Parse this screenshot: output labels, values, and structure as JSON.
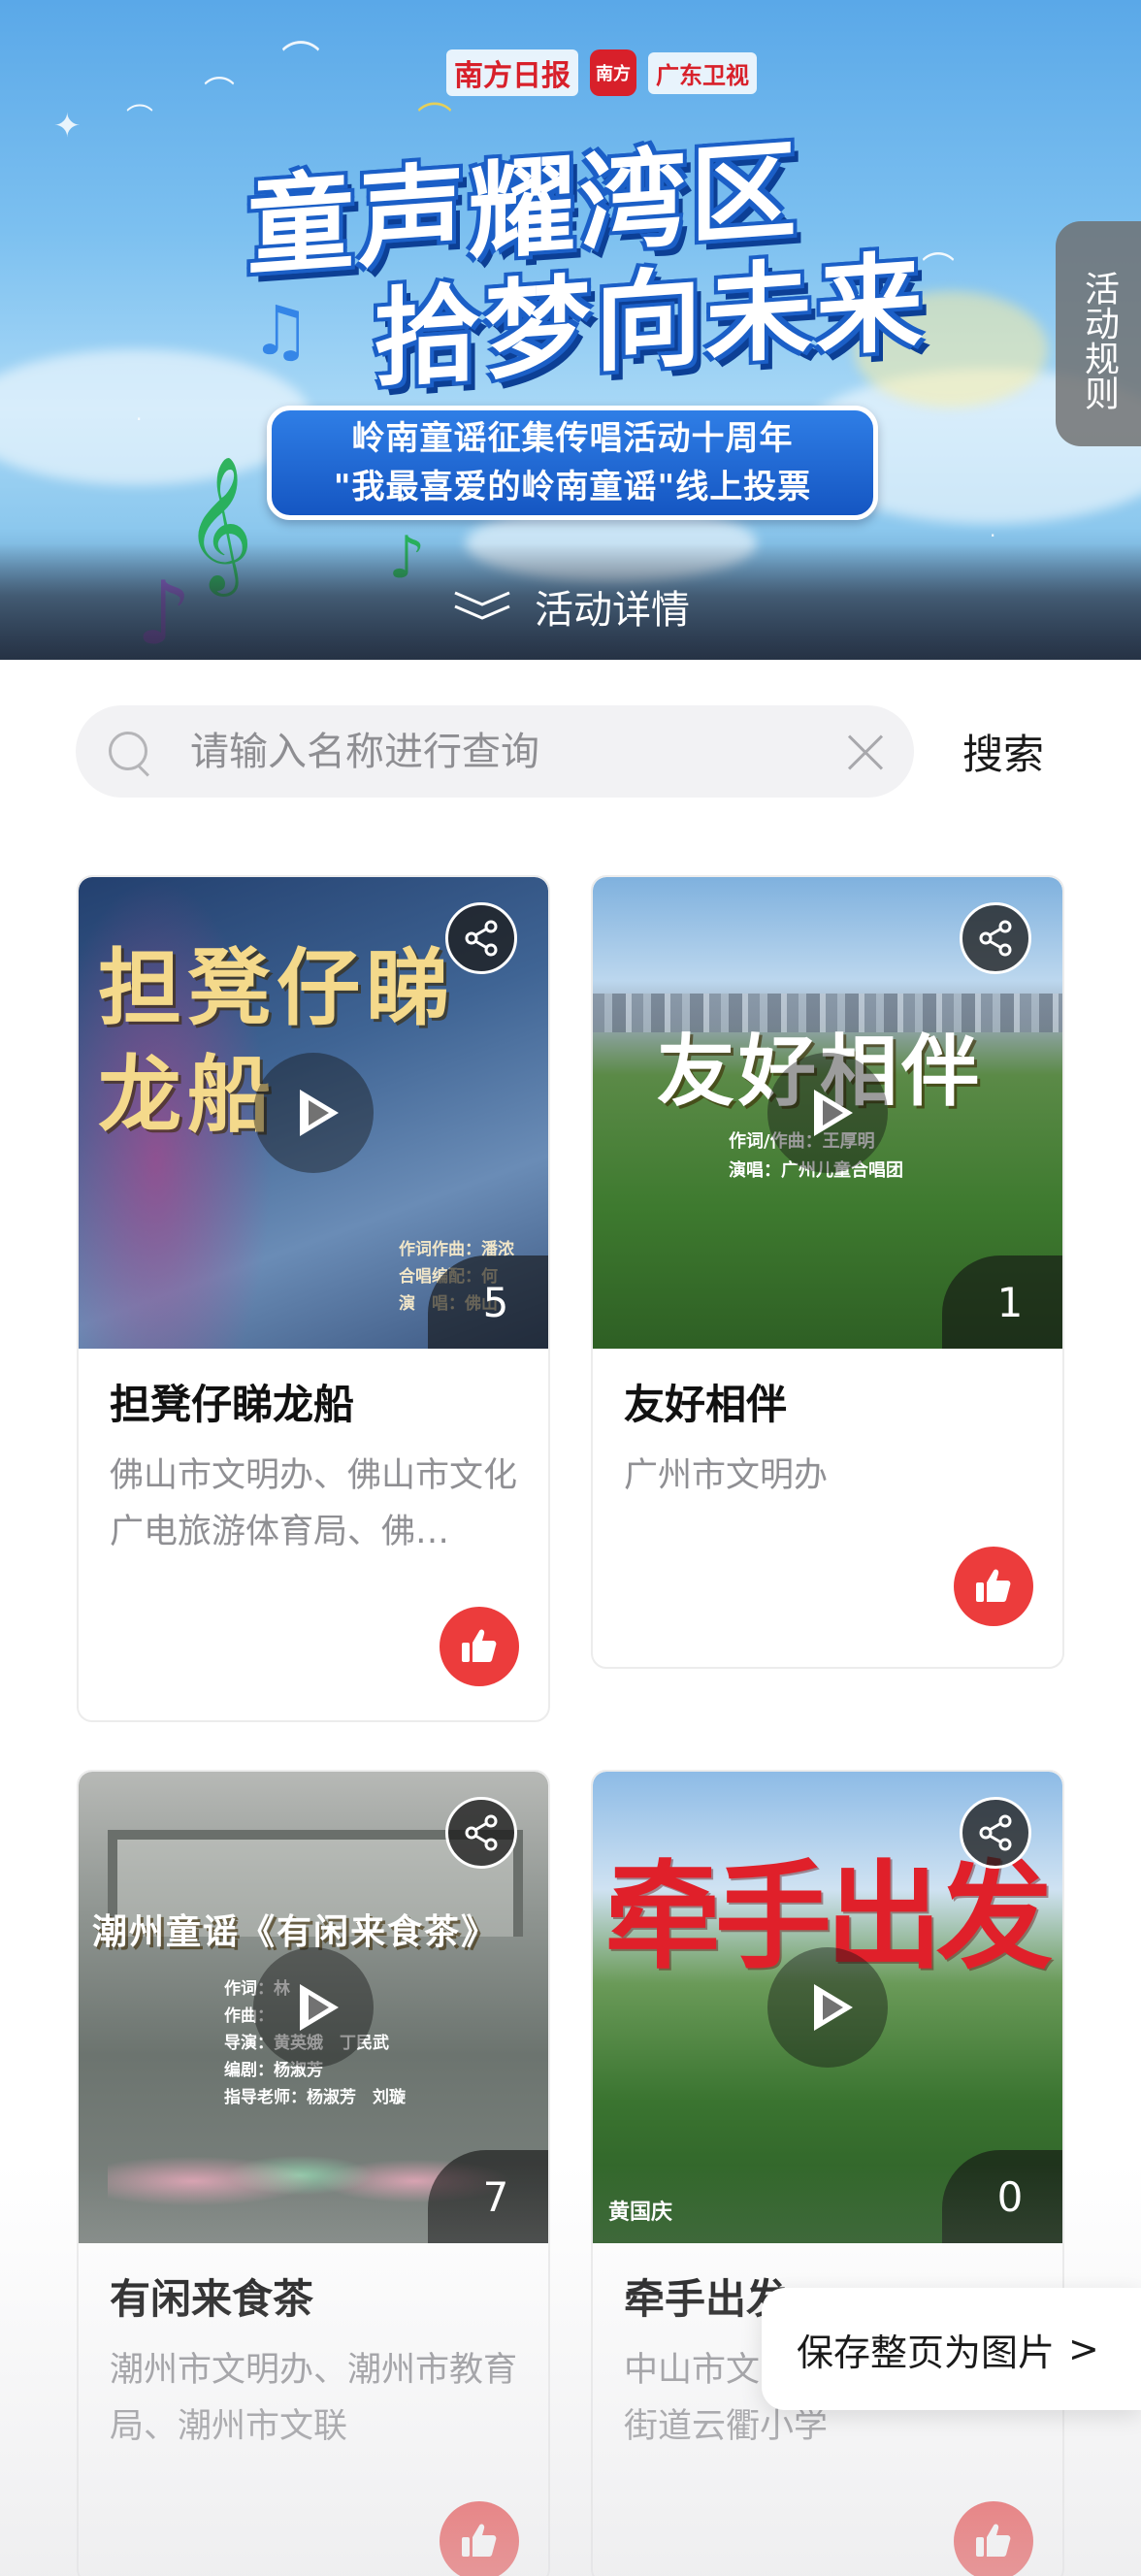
{
  "banner": {
    "logos": [
      "南方日报",
      "南方+",
      "广东卫视"
    ],
    "headline_line1": "童声耀湾区",
    "headline_line2": "拾梦向未来",
    "subtitle_line1": "岭南童谣征集传唱活动十周年",
    "subtitle_line2": "\"我最喜爱的岭南童谣\"线上投票",
    "rules_label": "活动规则",
    "detail_label": "活动详情"
  },
  "search": {
    "placeholder": "请输入名称进行查询",
    "value": "",
    "button_label": "搜索"
  },
  "cards": [
    {
      "thumb_title": "担凳仔睇龙船",
      "thumb_credits": "作词作曲：潘浓\n合唱编配：何\n演　唱：佛山",
      "title": "担凳仔睇龙船",
      "org": "佛山市文明办、佛山市文化广电旅游体育局、佛…",
      "count": "5",
      "colors": [
        "#2f4d7a",
        "#5e7fa8"
      ]
    },
    {
      "thumb_title": "友好相伴",
      "thumb_credits": "作词/作曲：王厚明\n演唱：广州儿童合唱团",
      "title": "友好相伴",
      "org": "广州市文明办",
      "count": "1",
      "colors": [
        "#8fb9e0",
        "#3f7a2e"
      ]
    },
    {
      "thumb_title": "潮州童谣《有闲来食茶》",
      "thumb_credits": "作词：林\n作曲：\n导演：黄英娥　丁民武\n编剧：杨淑芳\n指导老师：杨淑芳　刘璇",
      "title": "有闲来食茶",
      "org": "潮州市文明办、潮州市教育局、潮州市文联",
      "count": "7",
      "colors": [
        "#8a8d8c",
        "#5f6a62"
      ]
    },
    {
      "thumb_title": "牵手出发",
      "thumb_credits": "黄国庆",
      "title": "牵手出发",
      "org": "中山市文明办、中山市南朗街道云衢小学",
      "count": "0",
      "colors": [
        "#9cc4e8",
        "#2f6b35"
      ]
    }
  ],
  "save_float": {
    "label": "保存整页为图片",
    "arrow": ">"
  },
  "colors": {
    "like_red": "#ec3c3c",
    "banner_blue": "#1556c2"
  },
  "icons": [
    "search-icon",
    "clear-icon",
    "share-icon",
    "play-icon",
    "thumbs-up-icon",
    "chevron-down-icon",
    "chevron-right-icon"
  ]
}
